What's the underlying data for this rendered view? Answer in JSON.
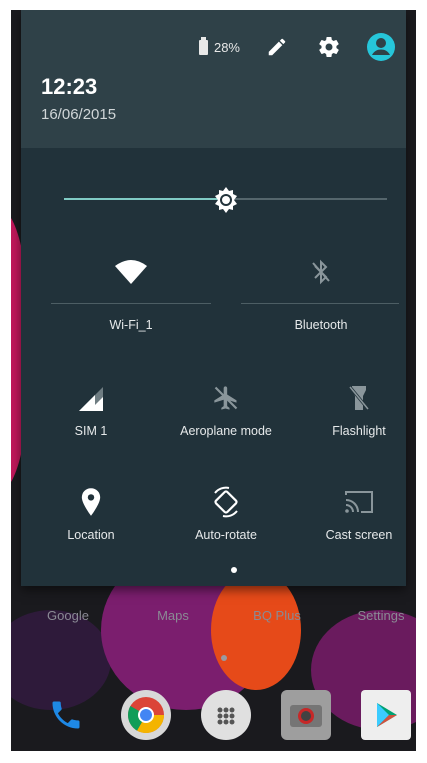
{
  "status": {
    "battery_percent": "28%",
    "icons": [
      "battery-icon",
      "edit-icon",
      "settings-icon",
      "account-icon"
    ]
  },
  "clock": {
    "time": "12:23",
    "date": "16/06/2015"
  },
  "brightness": {
    "level": 0.5
  },
  "tiles": {
    "wifi": {
      "label": "Wi-Fi_1",
      "icon": "wifi-icon",
      "active": true
    },
    "bluetooth": {
      "label": "Bluetooth",
      "icon": "bluetooth-off-icon",
      "active": false
    },
    "sim": {
      "label": "SIM 1",
      "icon": "signal-icon"
    },
    "aeroplane": {
      "label": "Aeroplane mode",
      "icon": "airplane-icon",
      "active": false
    },
    "flashlight": {
      "label": "Flashlight",
      "icon": "flashlight-off-icon",
      "active": false
    },
    "location": {
      "label": "Location",
      "icon": "location-icon",
      "active": true
    },
    "autorotate": {
      "label": "Auto-rotate",
      "icon": "rotate-icon",
      "active": true
    },
    "cast": {
      "label": "Cast screen",
      "icon": "cast-icon"
    }
  },
  "home": {
    "apps": [
      "Google",
      "Maps",
      "BQ Plus",
      "Settings"
    ],
    "dock": [
      "phone-icon",
      "chrome-icon",
      "app-drawer-icon",
      "camera-icon",
      "play-store-icon"
    ]
  },
  "colors": {
    "accent": "#80cbc4",
    "account": "#26c6da",
    "shade": "#21323a",
    "header": "#2f4148"
  }
}
